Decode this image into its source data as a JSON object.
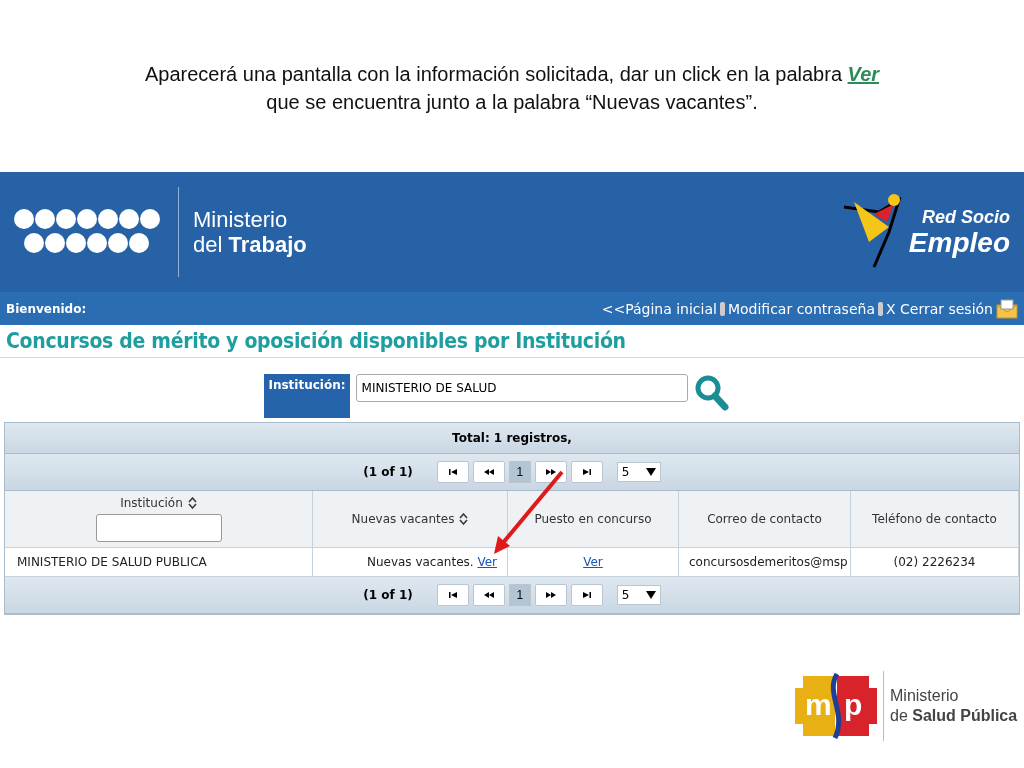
{
  "instruction": {
    "text": "Aparecerá una pantalla con la información solicitada, dar un click en la palabra",
    "link": "Ver",
    "text_2": "que se encuentra junto a la palabra “Nuevas vacantes”."
  },
  "header": {
    "logo_line_1": "Ministerio",
    "logo_line_2": "del **Trabajo**",
    "partner_line_1": "Red Socio",
    "partner_line_2": "Empleo"
  },
  "nav_bar": {
    "welcome": "Bienvenido:",
    "links": [
      "<<Página inicial",
      "Modificar contraseña",
      "X Cerrar sesión"
    ]
  },
  "page_title": "Concursos de mérito y oposición disponibles por Institución",
  "search": {
    "label": "Institución:",
    "value": "MINISTERIO DE SALUD"
  },
  "table": {
    "total": "Total: 1 registros,",
    "paginators": [
      {
        "summary": "(1 of 1)",
        "pages": [
          {
            "label": "1",
            "selected": true
          }
        ],
        "rows_per_page": "5"
      },
      {
        "summary": "(1 of 1)",
        "pages": [
          {
            "label": "1",
            "selected": true
          }
        ],
        "rows_per_page": "5"
      }
    ],
    "columns": [
      {
        "label": "Institución",
        "sortable": true,
        "filter": true
      },
      {
        "label": "Nuevas vacantes",
        "sortable": true,
        "filter": false
      },
      {
        "label": "Puesto en concurso",
        "sortable": false,
        "filter": false
      },
      {
        "label": "Correo de contacto",
        "sortable": false,
        "filter": false
      },
      {
        "label": "Teléfono de contacto",
        "sortable": false,
        "filter": false
      }
    ],
    "rows": [
      {
        "institution": "MINISTERIO DE SALUD PUBLICA",
        "vacancies_text": "Nuevas vacantes.",
        "vacancies_link": "Ver",
        "position_link": "Ver",
        "email": "concursosdemeritos@msp",
        "phone": "(02) 2226234"
      }
    ]
  },
  "footer_logo": {
    "letter_1": "m",
    "letter_2": "p",
    "line_1": "Ministerio",
    "line_2": "de **Salud Pública**"
  }
}
